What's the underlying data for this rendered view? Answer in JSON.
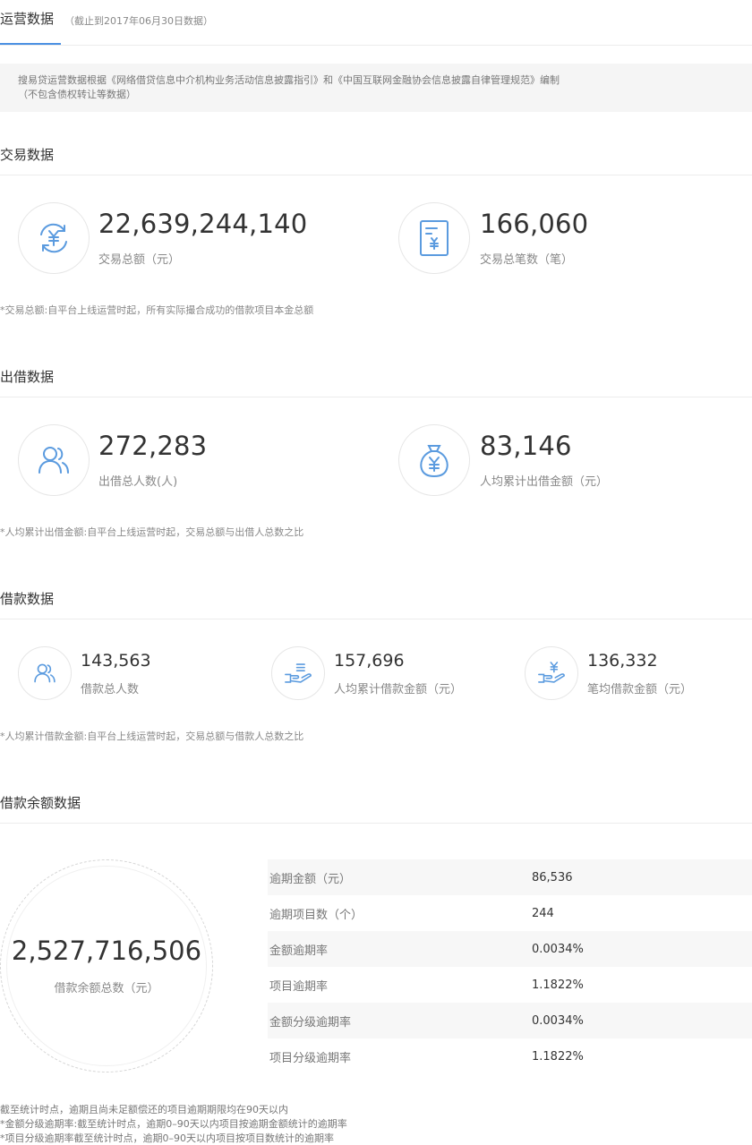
{
  "header": {
    "title": "运营数据",
    "subtitle": "（截止到2017年06月30日数据）"
  },
  "notice": {
    "line1": "搜易贷运营数据根据《网络借贷信息中介机构业务活动信息披露指引》和《中国互联网金融协会信息披露自律管理规范》编制",
    "line2": "（不包含债权转让等数据）"
  },
  "trade": {
    "title": "交易数据",
    "items": [
      {
        "icon": "exchange-yuan-icon",
        "value": "22,639,244,140",
        "label": "交易总额（元）"
      },
      {
        "icon": "document-yuan-icon",
        "value": "166,060",
        "label": "交易总笔数（笔）"
      }
    ],
    "note": "*交易总额:自平台上线运营时起，所有实际撮合成功的借款项目本金总额"
  },
  "lend": {
    "title": "出借数据",
    "items": [
      {
        "icon": "users-icon",
        "value": "272,283",
        "label": "出借总人数(人)"
      },
      {
        "icon": "money-bag-icon",
        "value": "83,146",
        "label": "人均累计出借金额（元）"
      }
    ],
    "note": "*人均累计出借金额:自平台上线运营时起，交易总额与出借人总数之比"
  },
  "borrow": {
    "title": "借款数据",
    "items": [
      {
        "icon": "users-icon",
        "value": "143,563",
        "label": "借款总人数"
      },
      {
        "icon": "hand-coins-icon",
        "value": "157,696",
        "label": "人均累计借款金额（元）"
      },
      {
        "icon": "hand-yuan-icon",
        "value": "136,332",
        "label": "笔均借款金额（元）"
      }
    ],
    "note": "*人均累计借款金额:自平台上线运营时起，交易总额与借款人总数之比"
  },
  "balance": {
    "title": "借款余额数据",
    "total_value": "2,527,716,506",
    "total_label": "借款余额总数（元）",
    "rows": [
      {
        "key": "逾期金额（元）",
        "value": "86,536"
      },
      {
        "key": "逾期项目数（个）",
        "value": "244"
      },
      {
        "key": "金额逾期率",
        "value": "0.0034%"
      },
      {
        "key": "项目逾期率",
        "value": "1.1822%"
      },
      {
        "key": "金额分级逾期率",
        "value": "0.0034%"
      },
      {
        "key": "项目分级逾期率",
        "value": "1.1822%"
      }
    ],
    "footnotes": [
      "截至统计时点，逾期且尚未足额偿还的项目逾期期限均在90天以内",
      "*金额分级逾期率:截至统计时点，逾期0–90天以内项目按逾期金额统计的逾期率",
      "*项目分级逾期率截至统计时点，逾期0–90天以内项目按项目数统计的逾期率"
    ]
  },
  "colors": {
    "accent": "#4a90e2",
    "icon": "#5b9bdf"
  }
}
